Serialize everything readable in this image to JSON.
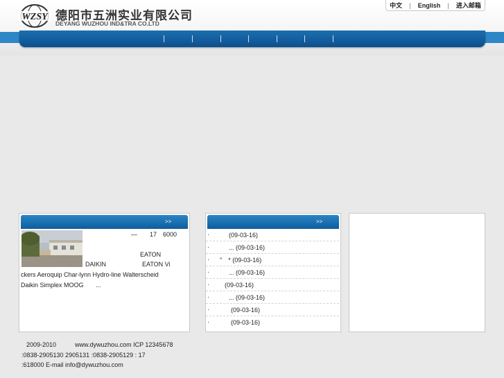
{
  "header": {
    "logo_mark_text": "WZSY",
    "company_cn": "德阳市五洲实业有限公司",
    "company_en": "DEYANG WUZHOU IND&TRA CO.LTD",
    "top_links": [
      "中文",
      "English",
      "进入邮箱"
    ],
    "separator": "|"
  },
  "colors": {
    "nav_blue": "#0e5d9c",
    "band_blue": "#2d86c5",
    "page_bg": "#e9e9e9"
  },
  "about": {
    "more_label": ">>",
    "intro_line1": "—　　17　6000",
    "intro_line2": "EATON",
    "intro_line3a": "DAIKIN",
    "intro_line3b": "EATON Vi",
    "intro_line4": "ckers Aeroquip Char-lynn Hydro-line Walterscheid",
    "intro_line5a": "Daikin Simplex MOOG",
    "intro_line5b": "..."
  },
  "news": {
    "more_label": ">>",
    "items": [
      {
        "bullet": "·",
        "text": "(09-03-16)"
      },
      {
        "bullet": "·",
        "text": "... (09-03-16)"
      },
      {
        "bullet": "·",
        "text": "\"　* (09-03-16)"
      },
      {
        "bullet": "·",
        "text": "... (09-03-16)"
      },
      {
        "bullet": "·",
        "text": "(09-03-16)"
      },
      {
        "bullet": "·",
        "text": "... (09-03-16)"
      },
      {
        "bullet": "·",
        "text": "(09-03-16)"
      },
      {
        "bullet": "·",
        "text": "(09-03-16)"
      }
    ]
  },
  "footer": {
    "line1": "2009-2010　　　www.dywuzhou.com  ICP 12345678",
    "line2": ":0838-2905130 2905131  :0838-2905129   :              17",
    "line3": ":618000 E-mail info@dywuzhou.com"
  }
}
